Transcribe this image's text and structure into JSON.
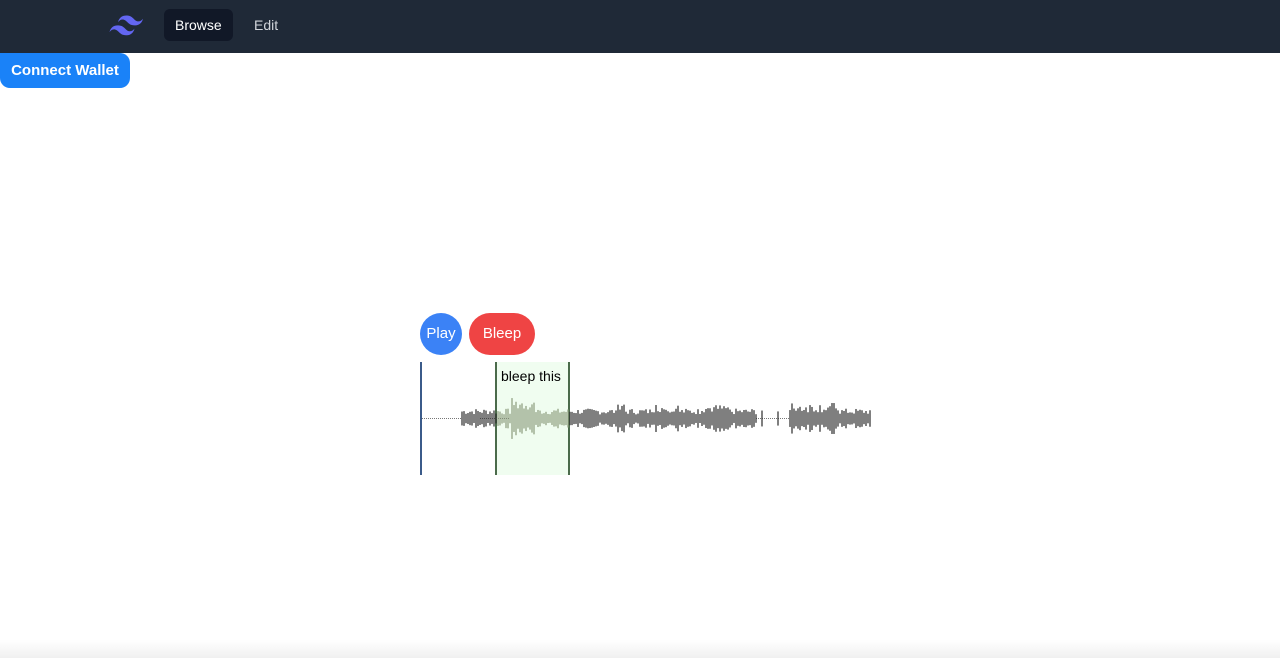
{
  "navbar": {
    "logo_icon": "tailwind-logo-icon",
    "logo_color": "#6366f1",
    "background": "#1f2937",
    "links": [
      {
        "label": "Browse",
        "active": true
      },
      {
        "label": "Edit",
        "active": false
      }
    ]
  },
  "wallet": {
    "connect_label": "Connect Wallet",
    "color": "#1a82f8"
  },
  "player": {
    "play_label": "Play",
    "play_color": "#3b82f6",
    "bleep_label": "Bleep",
    "bleep_color": "#ef4444",
    "region_label": "bleep this",
    "region_color": "#f0fdf0",
    "cursor_color": "#3b5b8a"
  }
}
